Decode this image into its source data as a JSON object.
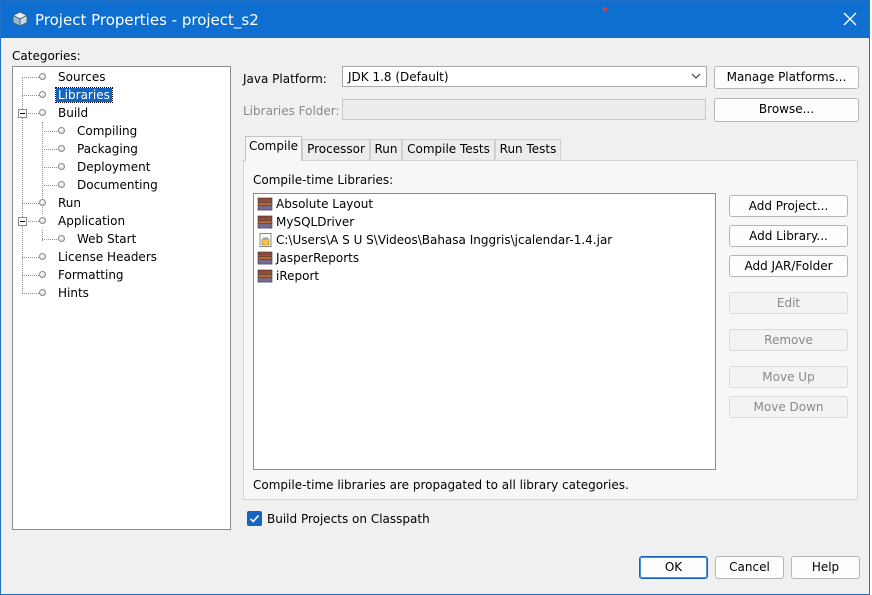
{
  "window": {
    "title": "Project Properties - project_s2"
  },
  "categories": {
    "label": "Categories:",
    "items": [
      {
        "label": "Sources"
      },
      {
        "label": "Libraries",
        "selected": true
      },
      {
        "label": "Build",
        "expanded": true
      },
      {
        "label": "Compiling"
      },
      {
        "label": "Packaging"
      },
      {
        "label": "Deployment"
      },
      {
        "label": "Documenting"
      },
      {
        "label": "Run"
      },
      {
        "label": "Application",
        "expanded": true
      },
      {
        "label": "Web Start"
      },
      {
        "label": "License Headers"
      },
      {
        "label": "Formatting"
      },
      {
        "label": "Hints"
      }
    ]
  },
  "platform": {
    "label": "Java Platform:",
    "value": "JDK 1.8 (Default)",
    "manage_button": "Manage Platforms..."
  },
  "libraries_folder": {
    "label": "Libraries Folder:",
    "value": "",
    "browse_button": "Browse..."
  },
  "tabs": [
    {
      "label": "Compile",
      "active": true
    },
    {
      "label": "Processor"
    },
    {
      "label": "Run"
    },
    {
      "label": "Compile Tests"
    },
    {
      "label": "Run Tests"
    }
  ],
  "compile": {
    "list_label": "Compile-time Libraries:",
    "libraries": [
      {
        "name": "Absolute Layout",
        "icon": "library-icon"
      },
      {
        "name": "MySQLDriver",
        "icon": "library-icon"
      },
      {
        "name": "C:\\Users\\A S U S\\Videos\\Bahasa Inggris\\jcalendar-1.4.jar",
        "icon": "jar-file-icon"
      },
      {
        "name": "JasperReports",
        "icon": "library-icon"
      },
      {
        "name": "iReport",
        "icon": "library-icon"
      }
    ],
    "buttons": {
      "add_project": "Add Project...",
      "add_library": "Add Library...",
      "add_jar": "Add JAR/Folder",
      "edit": "Edit",
      "remove": "Remove",
      "move_up": "Move Up",
      "move_down": "Move Down"
    },
    "note": "Compile-time libraries are propagated to all library categories."
  },
  "build_on_classpath": {
    "label": "Build Projects on Classpath",
    "checked": true
  },
  "footer": {
    "ok": "OK",
    "cancel": "Cancel",
    "help": "Help"
  },
  "colors": {
    "titlebar": "#0e6fd0",
    "selection": "#1565c0",
    "window_bg": "#f0f0f0"
  }
}
